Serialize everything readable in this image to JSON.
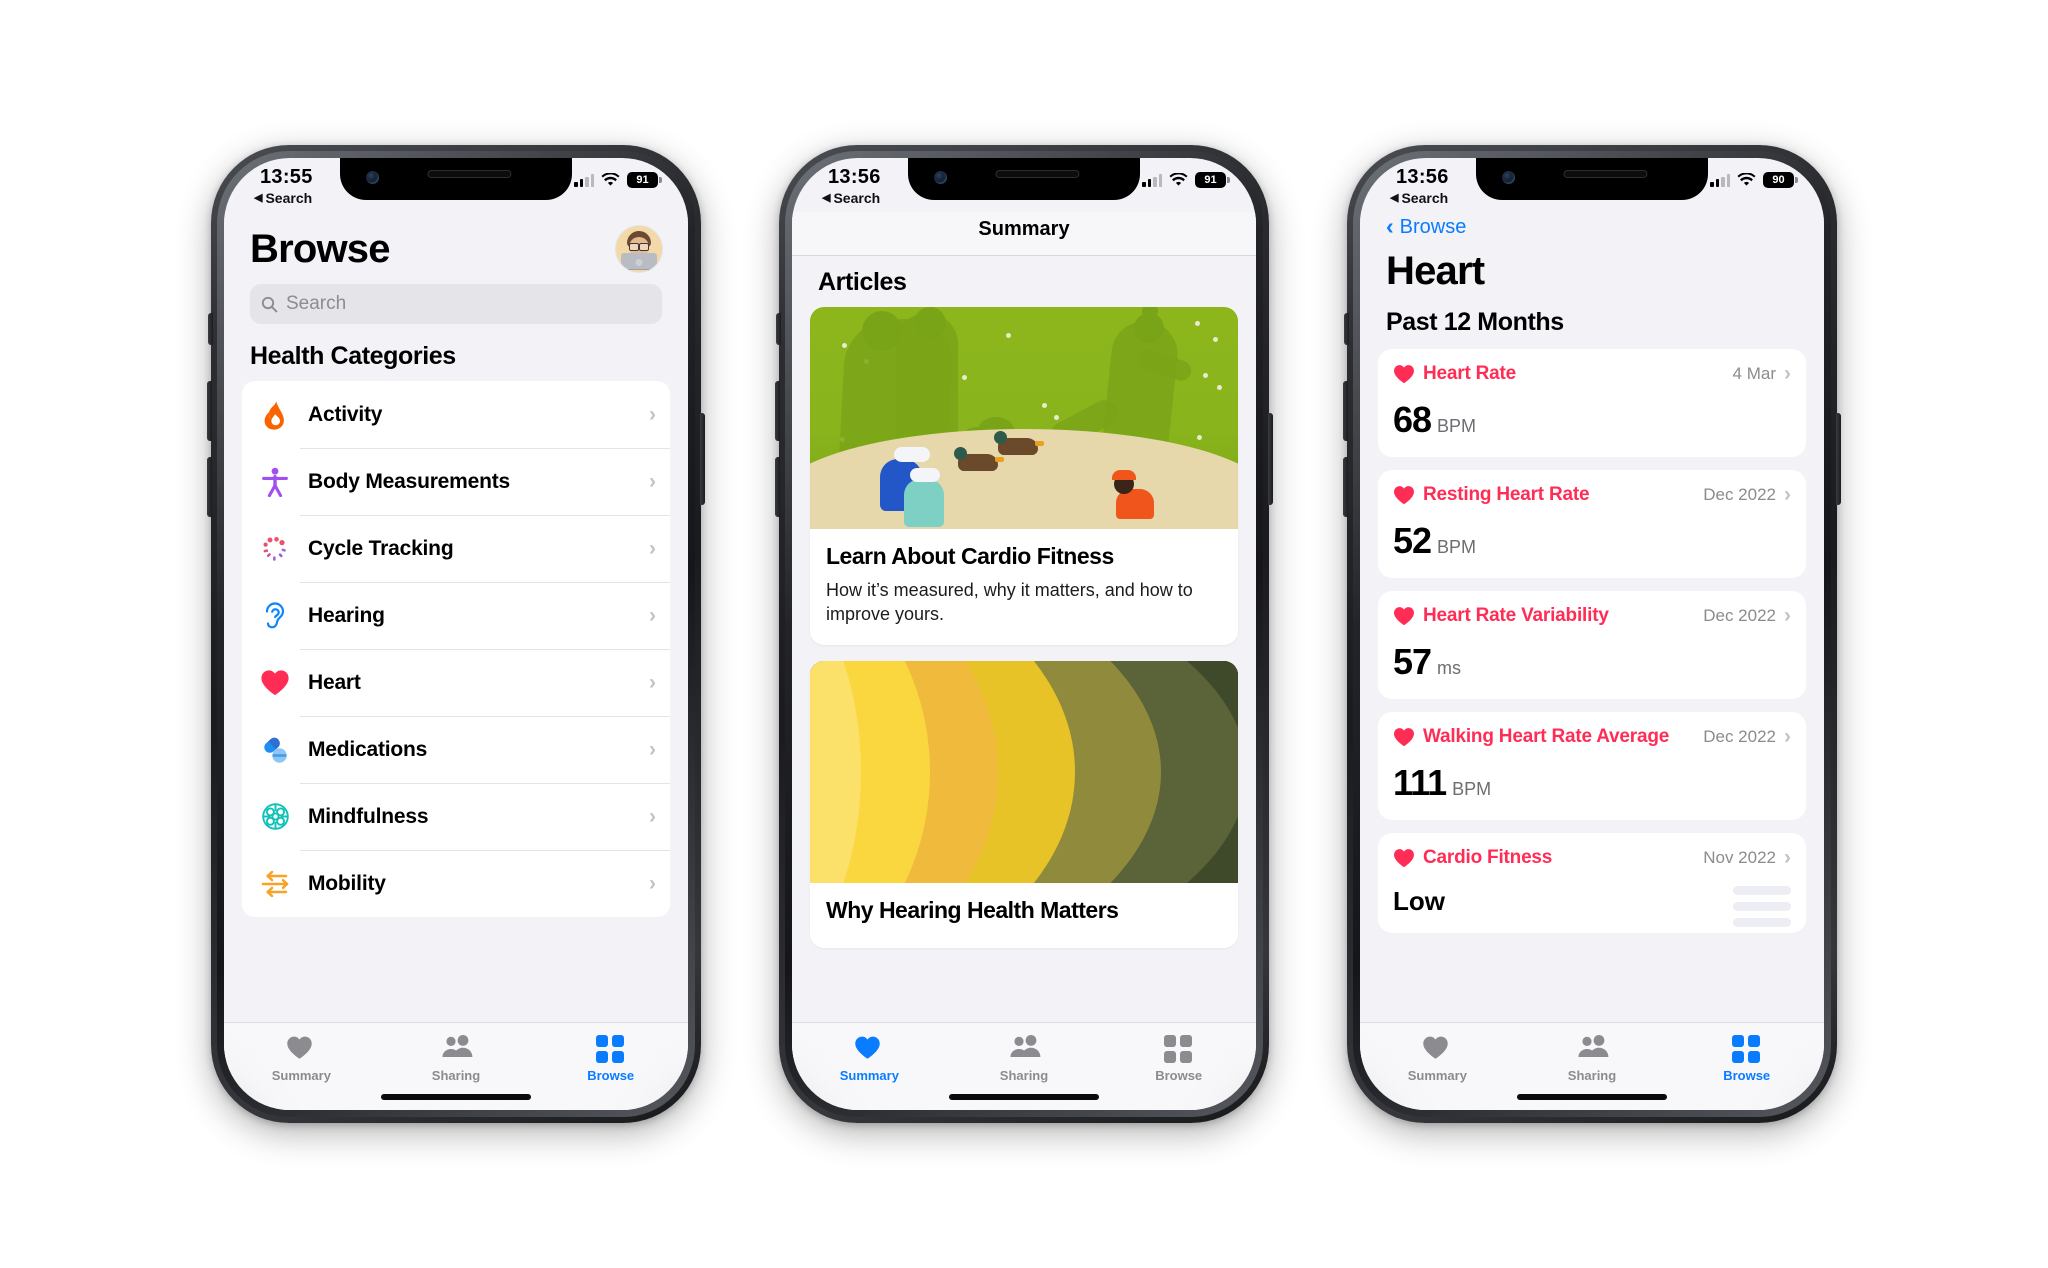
{
  "colors": {
    "accent_blue": "#0a7cff",
    "heart_red": "#ff2d55",
    "screen_bg": "#f2f2f7",
    "card_white": "#ffffff",
    "muted_text": "#8b8b90"
  },
  "phones": [
    {
      "id": "browse",
      "status": {
        "time": "13:55",
        "back_label": "Search",
        "back_icon": "triangle-left-icon",
        "battery": "91",
        "signal_icon": "signal-bars-icon",
        "wifi_icon": "wifi-icon"
      },
      "header": {
        "title": "Browse",
        "avatar_name": "user-avatar"
      },
      "search": {
        "placeholder": "Search",
        "icon": "search-icon"
      },
      "section_title": "Health Categories",
      "categories": [
        {
          "label": "Activity",
          "icon": "flame-icon",
          "color": "#fa6400"
        },
        {
          "label": "Body Measurements",
          "icon": "body-figure-icon",
          "color": "#a24ff0"
        },
        {
          "label": "Cycle Tracking",
          "icon": "cycle-dots-icon",
          "color": "#f0526d"
        },
        {
          "label": "Hearing",
          "icon": "ear-icon",
          "color": "#0a84ff"
        },
        {
          "label": "Heart",
          "icon": "heart-icon",
          "color": "#ff2d55"
        },
        {
          "label": "Medications",
          "icon": "pills-icon",
          "color": "#1e8ef0"
        },
        {
          "label": "Mindfulness",
          "icon": "brain-icon",
          "color": "#0fc2b8"
        },
        {
          "label": "Mobility",
          "icon": "arrows-icon",
          "color": "#f8a325"
        }
      ],
      "tabs": [
        {
          "label": "Summary",
          "icon": "heart-tab-icon",
          "selected": false
        },
        {
          "label": "Sharing",
          "icon": "people-tab-icon",
          "selected": false
        },
        {
          "label": "Browse",
          "icon": "grid-tab-icon",
          "selected": true
        }
      ]
    },
    {
      "id": "summary",
      "status": {
        "time": "13:56",
        "back_label": "Search",
        "back_icon": "triangle-left-icon",
        "battery": "91",
        "signal_icon": "signal-bars-icon",
        "wifi_icon": "wifi-icon"
      },
      "nav_title": "Summary",
      "section_title": "Articles",
      "articles": [
        {
          "title": "Learn About Cardio Fitness",
          "subtitle": "How it’s measured, why it matters, and how to improve yours.",
          "image_name": "park-silhouettes-illustration"
        },
        {
          "title": "Why Hearing Health Matters",
          "subtitle": "",
          "image_name": "layered-paper-arcs-illustration"
        }
      ],
      "tabs": [
        {
          "label": "Summary",
          "icon": "heart-tab-icon",
          "selected": true
        },
        {
          "label": "Sharing",
          "icon": "people-tab-icon",
          "selected": false
        },
        {
          "label": "Browse",
          "icon": "grid-tab-icon",
          "selected": false
        }
      ]
    },
    {
      "id": "heart",
      "status": {
        "time": "13:56",
        "back_label": "Search",
        "back_icon": "triangle-left-icon",
        "battery": "90",
        "signal_icon": "signal-bars-icon",
        "wifi_icon": "wifi-icon"
      },
      "back_button": {
        "label": "Browse",
        "icon": "chevron-left-icon"
      },
      "title": "Heart",
      "section_title": "Past 12 Months",
      "metrics": [
        {
          "name": "Heart Rate",
          "date": "4 Mar",
          "value": "68",
          "unit": "BPM",
          "icon": "heart-icon"
        },
        {
          "name": "Resting Heart Rate",
          "date": "Dec 2022",
          "value": "52",
          "unit": "BPM",
          "icon": "heart-icon"
        },
        {
          "name": "Heart Rate Variability",
          "date": "Dec 2022",
          "value": "57",
          "unit": "ms",
          "icon": "heart-icon"
        },
        {
          "name": "Walking Heart Rate Average",
          "date": "Dec 2022",
          "value": "111",
          "unit": "BPM",
          "icon": "heart-icon"
        },
        {
          "name": "Cardio Fitness",
          "date": "Nov 2022",
          "value": "Low",
          "unit": "",
          "icon": "heart-icon"
        }
      ],
      "tabs": [
        {
          "label": "Summary",
          "icon": "heart-tab-icon",
          "selected": false
        },
        {
          "label": "Sharing",
          "icon": "people-tab-icon",
          "selected": false
        },
        {
          "label": "Browse",
          "icon": "grid-tab-icon",
          "selected": true
        }
      ]
    }
  ]
}
